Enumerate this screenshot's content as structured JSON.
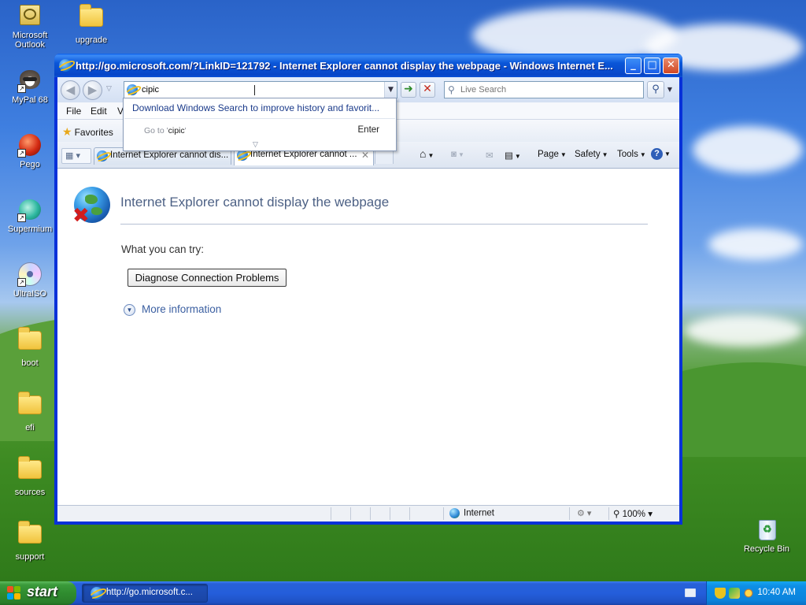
{
  "desktop": {
    "icons": [
      {
        "label": "Microsoft Outlook",
        "icon": "outlook-icon"
      },
      {
        "label": "upgrade",
        "icon": "folder-icon"
      },
      {
        "label": "MyPal 68",
        "icon": "mypal-icon"
      },
      {
        "label": "Pego",
        "icon": "pego-icon"
      },
      {
        "label": "Supermium",
        "icon": "supermium-icon"
      },
      {
        "label": "UltraISO",
        "icon": "ultraiso-icon"
      },
      {
        "label": "boot",
        "icon": "folder-icon"
      },
      {
        "label": "efi",
        "icon": "folder-icon"
      },
      {
        "label": "sources",
        "icon": "folder-icon"
      },
      {
        "label": "support",
        "icon": "folder-icon"
      },
      {
        "label": "Recycle Bin",
        "icon": "recycle-bin-icon"
      }
    ]
  },
  "window": {
    "title": "http://go.microsoft.com/?LinkID=121792 - Internet Explorer cannot display the webpage - Windows Internet E...",
    "controls": {
      "minimize": "_",
      "maximize": "□",
      "close": "✕"
    }
  },
  "nav": {
    "back": "◀",
    "forward": "▶",
    "address_value": "cipic",
    "search_placeholder": "Live Search"
  },
  "menu": {
    "items": [
      "File",
      "Edit",
      "Vi"
    ]
  },
  "favorites": {
    "label": "Favorites"
  },
  "autocomplete": {
    "download_link": "Download Windows Search to improve history and favorit...",
    "goto_prefix": "Go to '",
    "goto_query": "cipic",
    "goto_suffix": "'",
    "enter": "Enter",
    "more_arrow": "▽"
  },
  "tabs": [
    {
      "title": "Internet Explorer cannot dis...",
      "active": false
    },
    {
      "title": "Internet Explorer cannot ...",
      "active": true
    }
  ],
  "commandbar": {
    "page": "Page",
    "safety": "Safety",
    "tools": "Tools"
  },
  "content": {
    "error_title": "Internet Explorer cannot display the webpage",
    "try_label": "What you can try:",
    "diagnose_button": "Diagnose Connection Problems",
    "more_info": "More information"
  },
  "statusbar": {
    "zone": "Internet",
    "zoom": "100%"
  },
  "taskbar": {
    "start": "start",
    "task_item": "http://go.microsoft.c...",
    "clock": "10:40 AM"
  }
}
